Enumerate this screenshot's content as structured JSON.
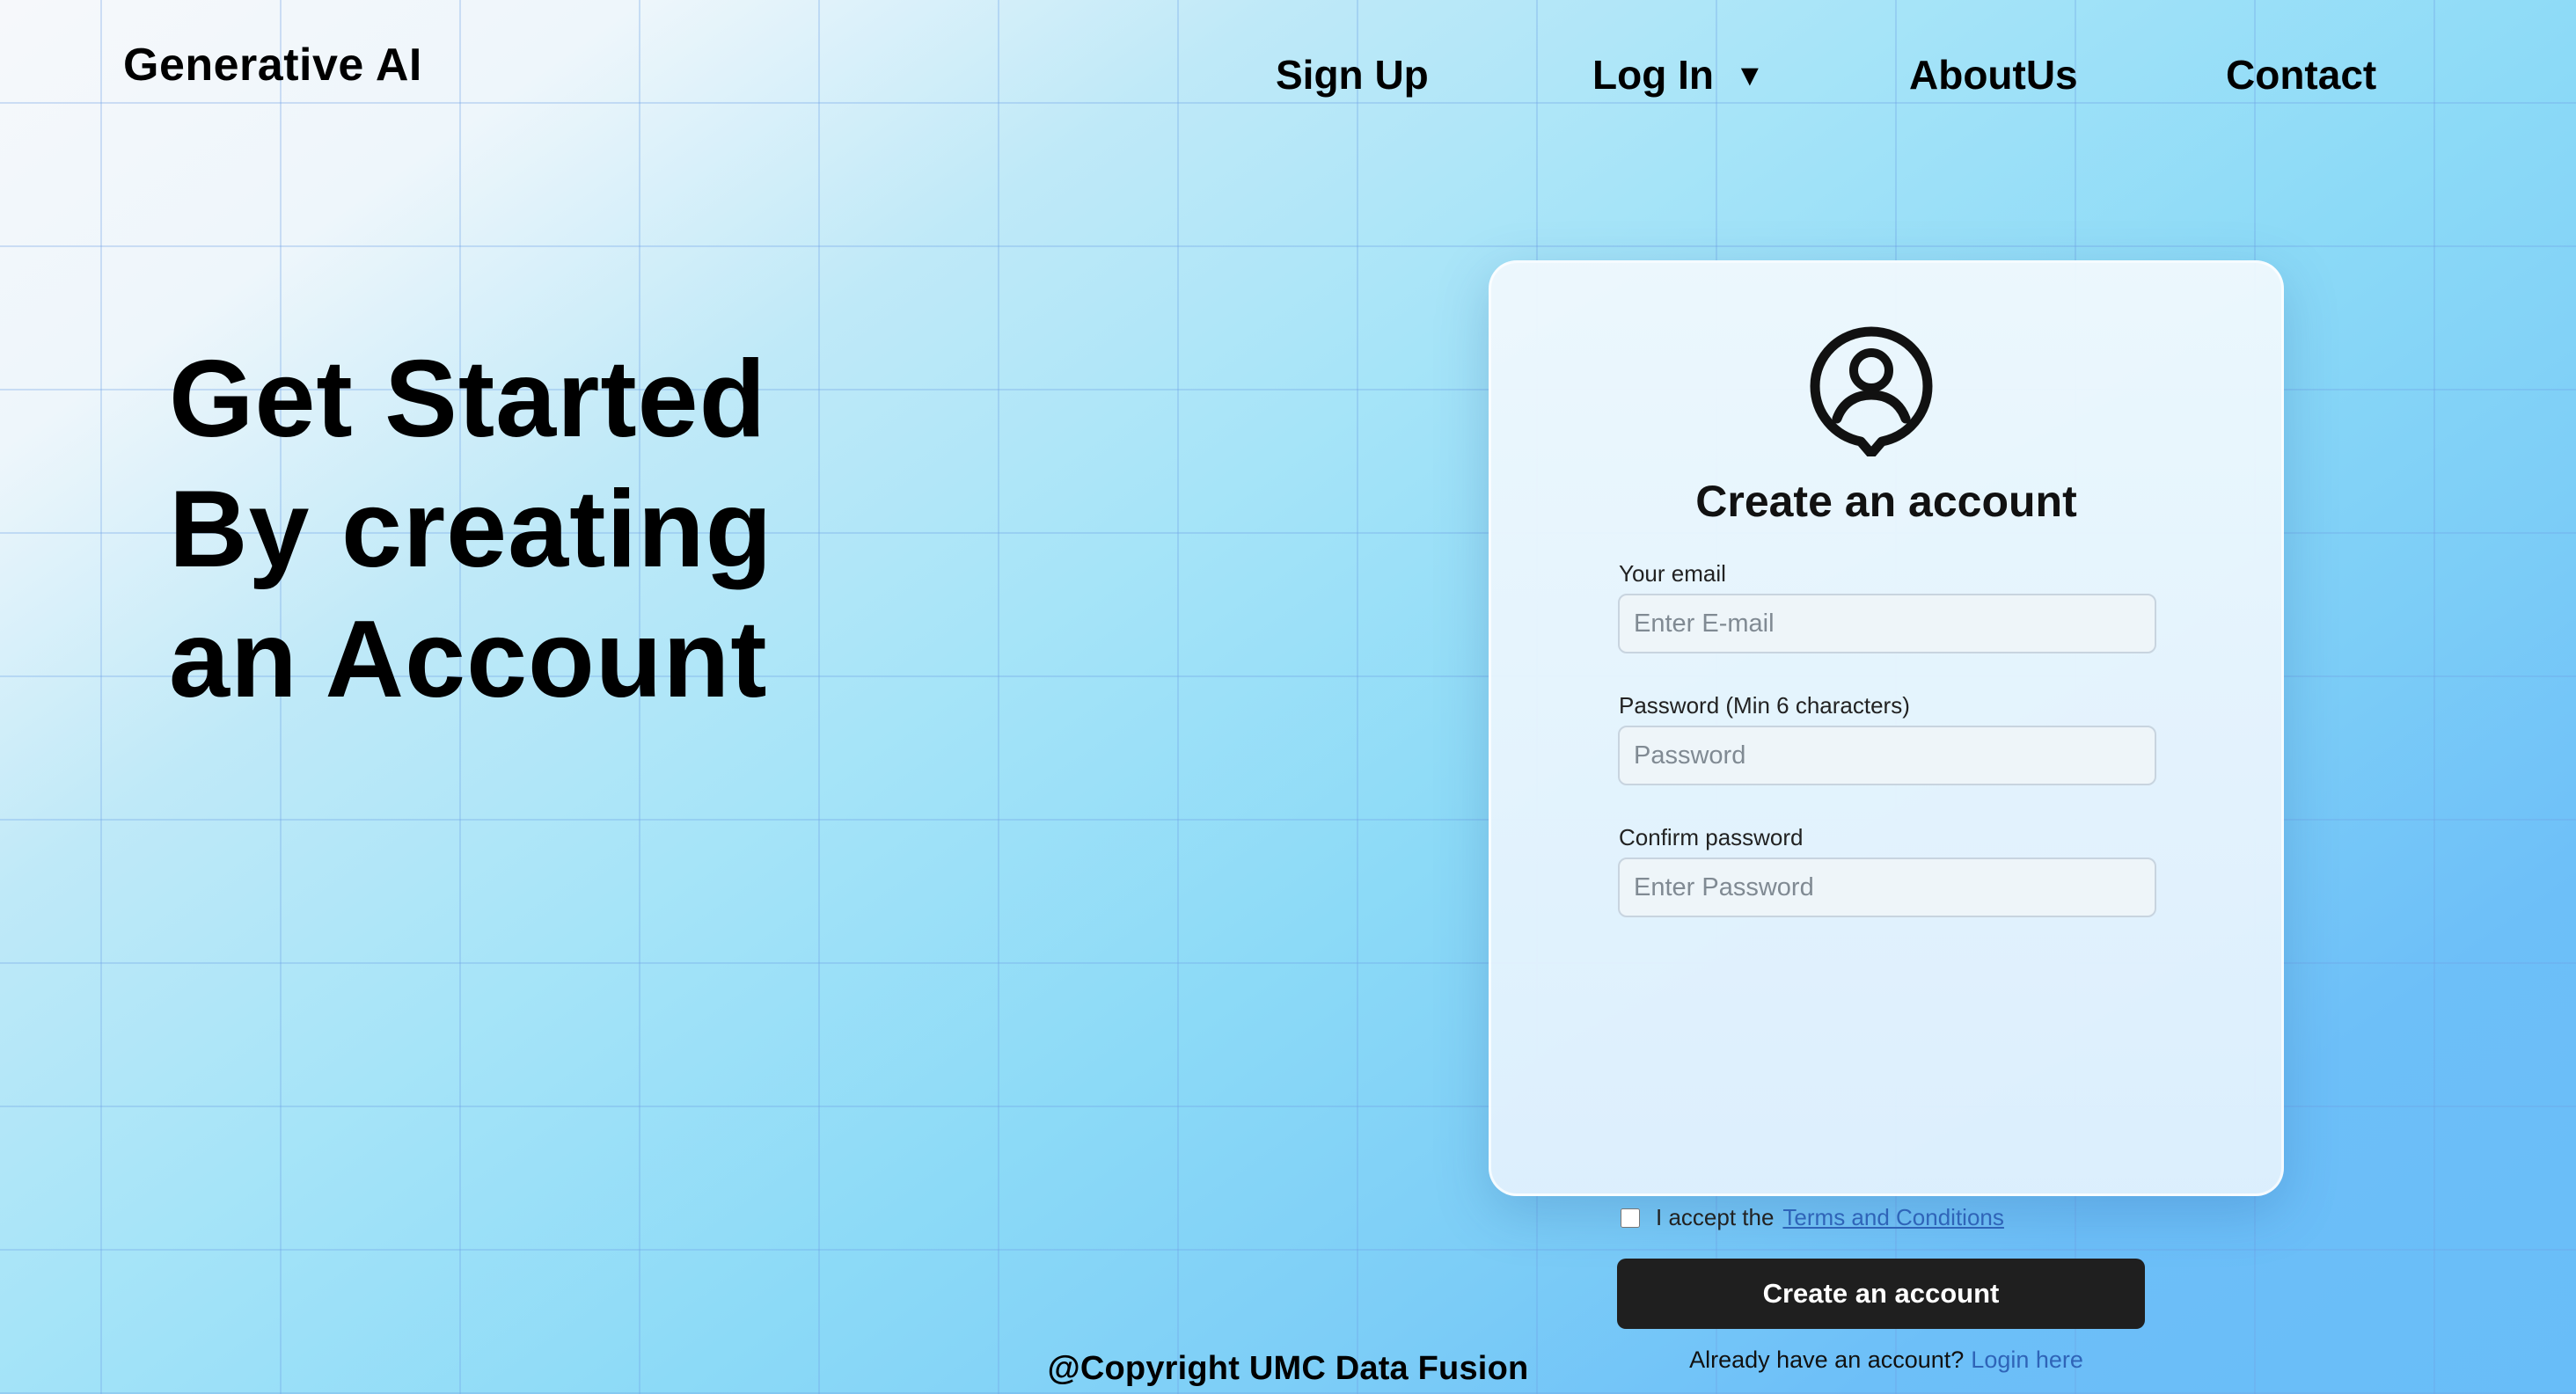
{
  "brand": "Generative AI",
  "nav": {
    "sign_up": "Sign Up",
    "log_in": "Log In",
    "about": "AboutUs",
    "contact": "Contact"
  },
  "hero": {
    "line1": "Get Started",
    "line2": "By creating",
    "line3": "an Account"
  },
  "form": {
    "title": "Create an account",
    "email": {
      "label": "Your email",
      "placeholder": "Enter E-mail",
      "value": ""
    },
    "password": {
      "label": "Password (Min 6 characters)",
      "placeholder": "Password",
      "value": ""
    },
    "confirm": {
      "label": "Confirm password",
      "placeholder": "Enter Password",
      "value": ""
    },
    "terms_prefix": "I accept the",
    "terms_link": "Terms and Conditions",
    "submit": "Create an account",
    "already": "Already have an account?",
    "login_link": "Login here"
  },
  "footer": "@Copyright UMC Data Fusion",
  "icons": {
    "avatar": "user-circle-icon",
    "nav_dropdown": "caret-down-icon"
  },
  "colors": {
    "button": "#1f1f1f",
    "link": "#2f64b8"
  }
}
